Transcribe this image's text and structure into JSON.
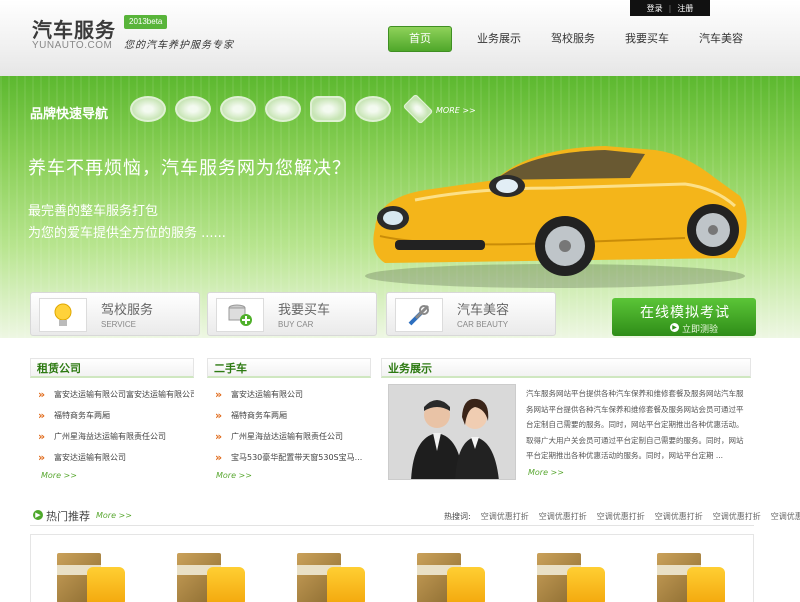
{
  "header": {
    "logo_title": "汽车服务",
    "logo_sub": "YUNAUTO.COM",
    "beta": "2013beta",
    "slogan": "您的汽车养护服务专家",
    "top_links": {
      "login": "登录",
      "separator": "|",
      "register": "注册"
    },
    "nav": [
      "首页",
      "业务展示",
      "驾校服务",
      "我要买车",
      "汽车美容"
    ]
  },
  "banner": {
    "brand_title": "品牌快速导航",
    "brand_more": "MORE >>",
    "hero_title": "养车不再烦恼，汽车服务网为您解决？",
    "hero_sub1": "最完善的整车服务打包",
    "hero_sub2": "为您的爱车提供全方位的服务 ......"
  },
  "tiles": [
    {
      "title": "驾校服务",
      "en": "SERVICE",
      "icon": "lightbulb-icon"
    },
    {
      "title": "我要买车",
      "en": "BUY CAR",
      "icon": "database-add-icon"
    },
    {
      "title": "汽车美容",
      "en": "CAR BEAUTY",
      "icon": "tools-icon"
    }
  ],
  "exam": {
    "title": "在线模拟考试",
    "sub": "立即测验"
  },
  "rental": {
    "title": "租赁公司",
    "items": [
      "富安达运输有限公司富安达运输有限公司...",
      "福特商务车两厢",
      "广州星海益达运输有限责任公司",
      "富安达运输有限公司"
    ],
    "more": "More >>"
  },
  "used": {
    "title": "二手车",
    "items": [
      "富安达运输有限公司",
      "福特商务车两厢",
      "广州星海益达运输有限责任公司",
      "宝马530豪华配置带天窗530S宝马..."
    ],
    "more": "More >>"
  },
  "business": {
    "title": "业务展示",
    "text": "汽车服务网站平台提供各种汽车保养和维修套餐及服务网站汽车服务网站平台提供各种汽车保养和维修套餐及服务网站会员可通过平台定制自己需要的服务。同时，网站平台定期推出各种优惠活动。取得广大用户关会员可通过平台定制自己需要的服务。同时，网站平台定期推出各种优惠活动的服务。同时，网站平台定期 ...",
    "more": "More >>"
  },
  "hot": {
    "title": "热门推荐",
    "more": "More >>",
    "keys_label": "热搜词:",
    "keys": [
      "空调优惠打折",
      "空调优惠打折",
      "空调优惠打折",
      "空调优惠打折",
      "空调优惠打折",
      "空调优惠打折"
    ]
  },
  "colors": {
    "brand_green": "#4fa72a",
    "accent_orange": "#e06a1a",
    "car_yellow": "#f4b51a"
  }
}
